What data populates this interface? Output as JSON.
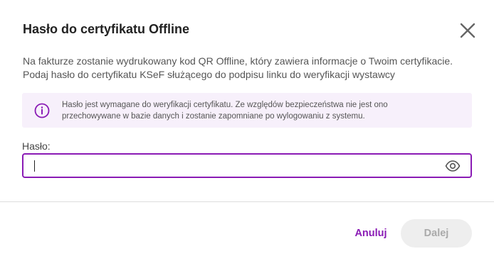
{
  "dialog": {
    "title": "Hasło do certyfikatu Offline",
    "description_lines": [
      "Na fakturze zostanie wydrukowany kod QR Offline, który zawiera informacje o Twoim certyfikacie.",
      "Podaj hasło do certyfikatu KSeF służącego do podpisu linku do weryfikacji wystawcy"
    ],
    "info": {
      "icon": "info-icon",
      "lines": [
        "Hasło jest wymagane do weryfikacji certyfikatu. Ze względów bezpieczeństwa nie jest ono",
        "przechowywane w bazie danych i zostanie zapomniane po wylogowaniu z systemu."
      ]
    },
    "password": {
      "label": "Hasło:",
      "value": "",
      "placeholder": "",
      "toggle_icon": "eye-icon"
    },
    "actions": {
      "cancel_label": "Anuluj",
      "next_label": "Dalej"
    },
    "close_icon": "close-icon"
  },
  "colors": {
    "accent": "#8a1bb5",
    "info_background": "#f7f0fb",
    "disabled_button_bg": "#eeeeee",
    "disabled_button_text": "#aaaaaa"
  }
}
